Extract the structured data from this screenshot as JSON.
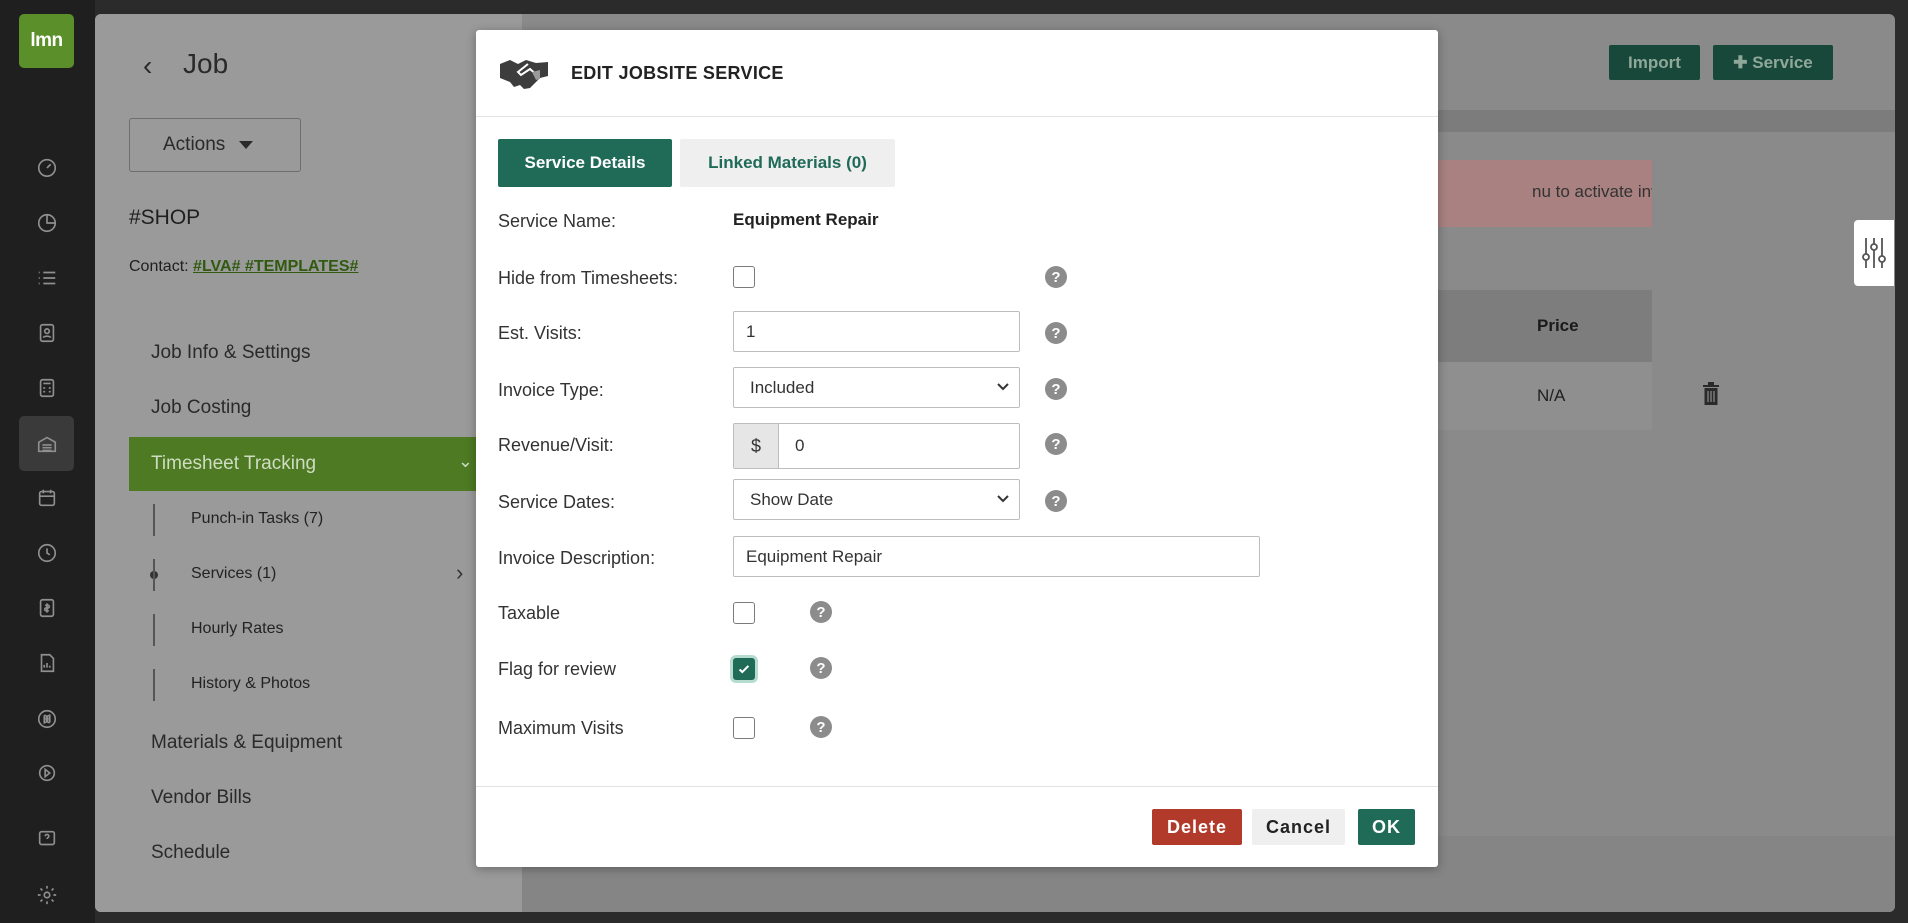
{
  "app": {
    "logo_text": "lmn",
    "rail_icons": [
      "dashboard-icon",
      "pie-chart-icon",
      "list-icon",
      "contact-card-icon",
      "calculator-icon",
      "warehouse-icon",
      "calendar-icon",
      "clock-icon",
      "invoice-icon",
      "report-icon",
      "quickbooks-icon",
      "play-icon",
      "help-icon",
      "gear-icon"
    ]
  },
  "page": {
    "title": "Job",
    "actions_label": "Actions",
    "shop": "#SHOP",
    "contact_label": "Contact:",
    "contact_link": "#LVA# #TEMPLATES#",
    "nav": {
      "job_info": "Job Info & Settings",
      "job_costing": "Job Costing",
      "timesheet_tracking": "Timesheet Tracking",
      "materials": "Materials & Equipment",
      "vendor_bills": "Vendor Bills",
      "schedule": "Schedule"
    },
    "subnav": {
      "punch_in": "Punch-in Tasks",
      "punch_in_count": "(7)",
      "services": "Services",
      "services_count": "(1)",
      "hourly_rates": "Hourly Rates",
      "history": "History & Photos"
    },
    "import_label": "Import",
    "service_label": "Service",
    "warning_text": "nu to activate invoicing",
    "table": {
      "price_header": "Price",
      "price_value": "N/A"
    }
  },
  "modal": {
    "title": "EDIT JOBSITE SERVICE",
    "tabs": {
      "details": "Service Details",
      "linked": "Linked Materials (0)"
    },
    "fields": {
      "service_name_label": "Service Name:",
      "service_name_value": "Equipment Repair",
      "hide_label": "Hide from Timesheets:",
      "hide_checked": false,
      "visits_label": "Est. Visits:",
      "visits_value": "1",
      "invoice_type_label": "Invoice Type:",
      "invoice_type_value": "Included",
      "revenue_label": "Revenue/Visit:",
      "revenue_prefix": "$",
      "revenue_value": "0",
      "dates_label": "Service Dates:",
      "dates_value": "Show Date",
      "desc_label": "Invoice Description:",
      "desc_value": "Equipment Repair",
      "taxable_label": "Taxable",
      "taxable_checked": false,
      "flag_label": "Flag for review",
      "flag_checked": true,
      "max_visits_label": "Maximum Visits",
      "max_visits_checked": false
    },
    "help_glyph": "?",
    "buttons": {
      "delete": "Delete",
      "cancel": "Cancel",
      "ok": "OK"
    }
  }
}
